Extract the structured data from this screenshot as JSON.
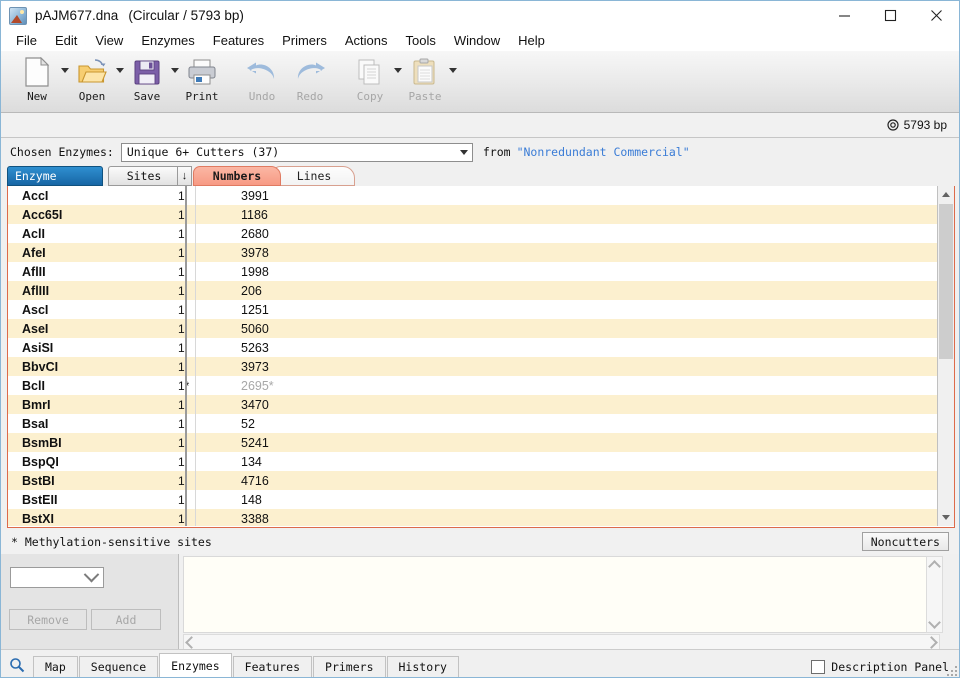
{
  "window": {
    "title": "pAJM677.dna",
    "subtitle": "(Circular / 5793 bp)",
    "icon": "dna-file-icon",
    "minimize_label": "minimize-icon",
    "maximize_label": "maximize-icon",
    "close_label": "close-icon"
  },
  "menu": {
    "items": [
      {
        "label": "File"
      },
      {
        "label": "Edit"
      },
      {
        "label": "View"
      },
      {
        "label": "Enzymes"
      },
      {
        "label": "Features"
      },
      {
        "label": "Primers"
      },
      {
        "label": "Actions"
      },
      {
        "label": "Tools"
      },
      {
        "label": "Window"
      },
      {
        "label": "Help"
      }
    ]
  },
  "toolbar": {
    "buttons": [
      {
        "label": "New",
        "icon": "new-document-icon",
        "enabled": true,
        "dropdown": true
      },
      {
        "label": "Open",
        "icon": "open-folder-icon",
        "enabled": true,
        "dropdown": true
      },
      {
        "label": "Save",
        "icon": "floppy-disk-icon",
        "enabled": true,
        "dropdown": true
      },
      {
        "label": "Print",
        "icon": "printer-icon",
        "enabled": true,
        "dropdown": false
      },
      {
        "label": "Undo",
        "icon": "undo-arrow-icon",
        "enabled": false,
        "dropdown": false
      },
      {
        "label": "Redo",
        "icon": "redo-arrow-icon",
        "enabled": false,
        "dropdown": false
      },
      {
        "label": "Copy",
        "icon": "copy-pages-icon",
        "enabled": false,
        "dropdown": true
      },
      {
        "label": "Paste",
        "icon": "clipboard-icon",
        "enabled": false,
        "dropdown": true
      }
    ]
  },
  "status": {
    "bp_icon": "circular-plasmid-icon",
    "bp_text": "5793 bp"
  },
  "chosen": {
    "label": "Chosen Enzymes:",
    "selected": "Unique 6+ Cutters   (37)",
    "dropdown_icon": "chevron-down-icon",
    "from_label": "from",
    "from_value": "\"Nonredundant Commercial\"",
    "from_color": "#3a7cd6"
  },
  "columns": {
    "enzyme": "Enzyme",
    "sites": "Sites",
    "sort_icon": "sort-descending-arrow-icon",
    "tab_numbers": "Numbers",
    "tab_lines": "Lines",
    "active_tab": "Numbers",
    "accent_color": "#f79a84"
  },
  "enzyme_table": {
    "rows": [
      {
        "enzyme": "AccI",
        "sites": "1",
        "number": "3991",
        "muted": false
      },
      {
        "enzyme": "Acc65I",
        "sites": "1",
        "number": "1186",
        "muted": false
      },
      {
        "enzyme": "AclI",
        "sites": "1",
        "number": "2680",
        "muted": false
      },
      {
        "enzyme": "AfeI",
        "sites": "1",
        "number": "3978",
        "muted": false
      },
      {
        "enzyme": "AflII",
        "sites": "1",
        "number": "1998",
        "muted": false
      },
      {
        "enzyme": "AflIII",
        "sites": "1",
        "number": "206",
        "muted": false
      },
      {
        "enzyme": "AscI",
        "sites": "1",
        "number": "1251",
        "muted": false
      },
      {
        "enzyme": "AseI",
        "sites": "1",
        "number": "5060",
        "muted": false
      },
      {
        "enzyme": "AsiSI",
        "sites": "1",
        "number": "5263",
        "muted": false
      },
      {
        "enzyme": "BbvCI",
        "sites": "1",
        "number": "3973",
        "muted": false
      },
      {
        "enzyme": "BclI",
        "sites": "1*",
        "number": "2695*",
        "muted": true
      },
      {
        "enzyme": "BmrI",
        "sites": "1",
        "number": "3470",
        "muted": false
      },
      {
        "enzyme": "BsaI",
        "sites": "1",
        "number": "52",
        "muted": false
      },
      {
        "enzyme": "BsmBI",
        "sites": "1",
        "number": "5241",
        "muted": false
      },
      {
        "enzyme": "BspQI",
        "sites": "1",
        "number": "134",
        "muted": false
      },
      {
        "enzyme": "BstBI",
        "sites": "1",
        "number": "4716",
        "muted": false
      },
      {
        "enzyme": "BstEII",
        "sites": "1",
        "number": "148",
        "muted": false
      },
      {
        "enzyme": "BstXI",
        "sites": "1",
        "number": "3388",
        "muted": false
      }
    ]
  },
  "footnote": {
    "text": "* Methylation-sensitive sites",
    "noncutters_button": "Noncutters"
  },
  "lower_left": {
    "combo_value": "",
    "combo_icon": "chevron-down-icon",
    "remove_button": "Remove",
    "add_button": "Add"
  },
  "bottom": {
    "search_icon": "search-magnifier-icon",
    "tabs": [
      {
        "label": "Map",
        "active": false
      },
      {
        "label": "Sequence",
        "active": false
      },
      {
        "label": "Enzymes",
        "active": true
      },
      {
        "label": "Features",
        "active": false
      },
      {
        "label": "Primers",
        "active": false
      },
      {
        "label": "History",
        "active": false
      }
    ],
    "description_panel_label": "Description Panel",
    "description_panel_checked": false
  }
}
